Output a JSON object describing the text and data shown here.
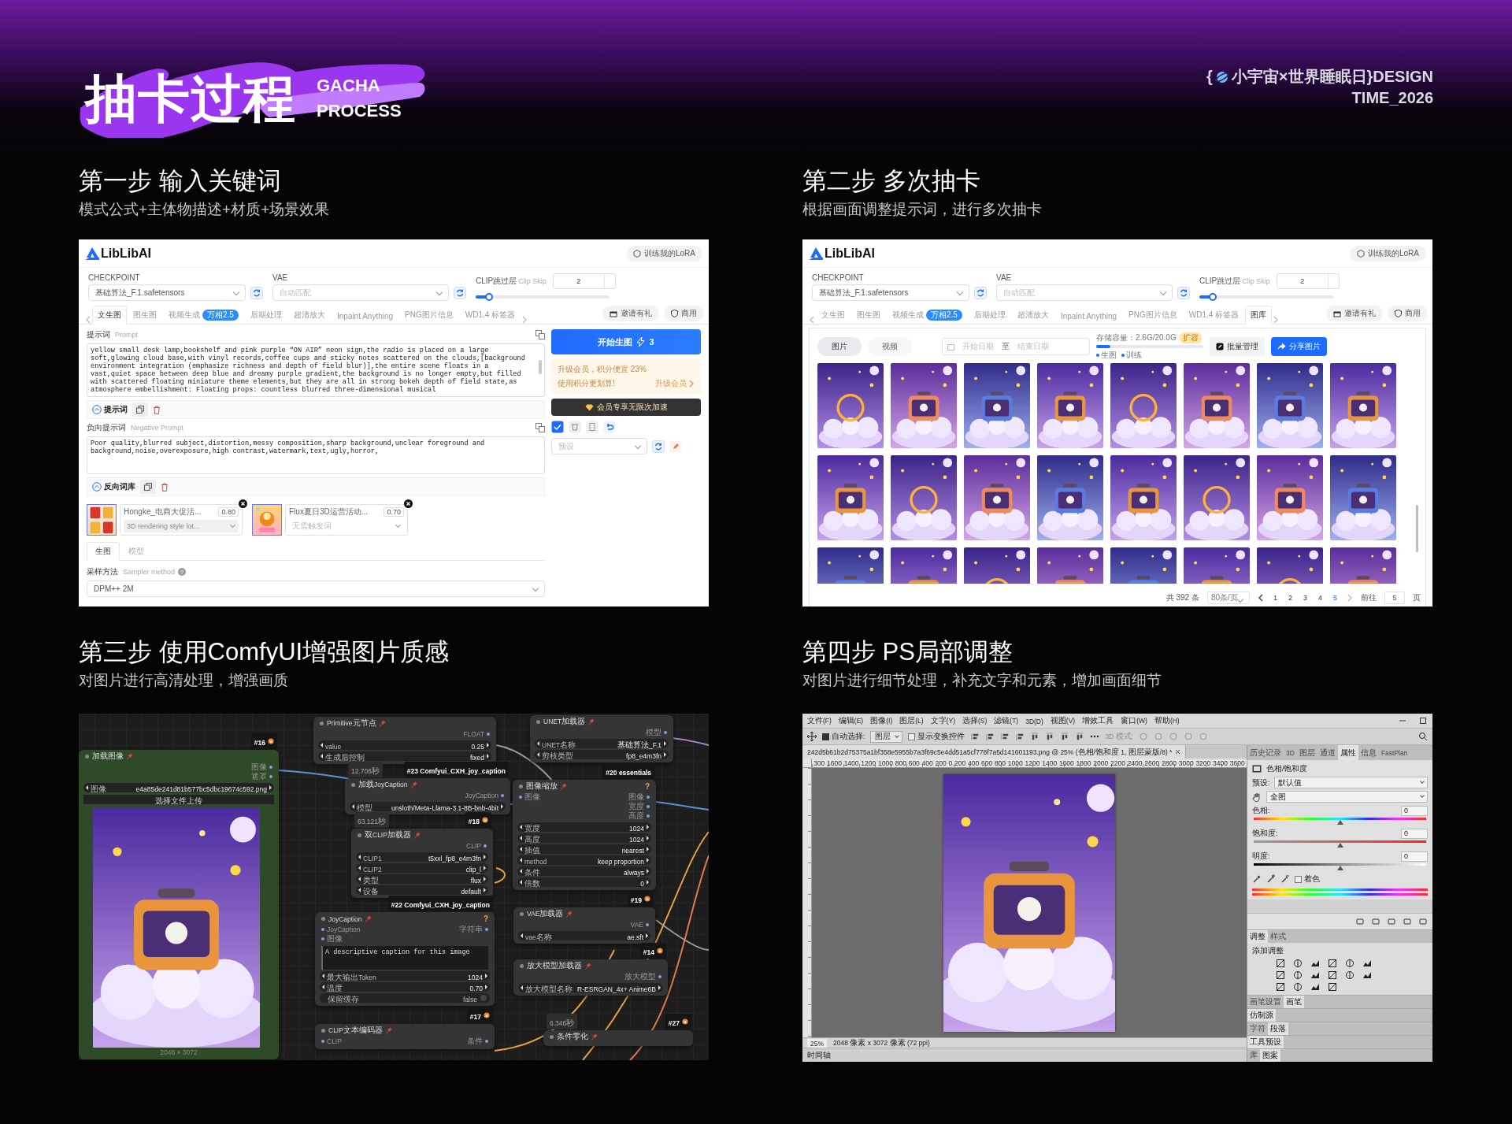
{
  "header": {
    "title": "抽卡过程",
    "tagline": [
      "GACHA",
      "PROCESS"
    ],
    "credit": {
      "open": "{",
      "name": "小宇宙×世界睡眠日}DESIGN",
      "line_2": "TIME_2026"
    }
  },
  "steps": [
    {
      "title": "第一步 输入关键词",
      "subtitle": "模式公式+主体物描述+材质+场景效果",
      "screen": {
        "kind": "generate",
        "brand": "LibLibAI",
        "lora_button": "训练我的LoRA",
        "checkpoint": {
          "label": "CHECKPOINT",
          "value": "基础算法_F.1.safetensors"
        },
        "vae": {
          "label": "VAE",
          "placeholder": "自动匹配"
        },
        "clip_skip": {
          "label": "CLIP跳过层",
          "hint": "Clip Skip",
          "value": "2",
          "level": 0.1
        },
        "tabs": [
          {
            "label": "文生图",
            "selected": true
          },
          {
            "label": "图生图",
            "selected": false
          },
          {
            "label": "视频生成",
            "badge": "万相2.5",
            "selected": false
          },
          {
            "label": "后期处理",
            "selected": false
          },
          {
            "label": "超清放大",
            "selected": false
          },
          {
            "label": "Inpaint Anything",
            "selected": false
          },
          {
            "label": "PNG图片信息",
            "selected": false
          },
          {
            "label": "WD1.4 标签器",
            "selected": false
          }
        ],
        "invite_button": "邀请有礼",
        "commercial_button": "商用",
        "prompt": {
          "label": "提示词",
          "hint": "Prompt",
          "value": "yellow small desk lamp,bookshelf and pink purple “ON AIR” neon sign,the radio is placed on a large soft,glowing cloud base,with vinyl records,coffee cups and sticky notes scattered on the clouds,[background environment integration (emphasize richness and depth of field blur)],the entire scene floats in a vast,quiet space between deep blue and dreamy purple gradient,the background is no longer empty,but filled with scattered floating miniature theme elements,but they are all in strong bokeh depth of field state,as atmosphere embellishment: Floating props: countless blurred three-dimensional musical",
          "toggle": "提示词"
        },
        "negative_prompt": {
          "label": "负向提示词",
          "hint": "Negative Prompt",
          "value": "Poor quality,blurred subject,distortion,messy composition,sharp background,unclear foreground and background,noise,overexposure,high contrast,watermark,text,ugly,horror,",
          "toggle": "反向词库"
        },
        "loras": [
          {
            "name": "Hongke_电商大促活...",
            "weight": "0.80",
            "trigger": "3D rendering style lot..."
          },
          {
            "name": "Flux夏日3D运营活动...",
            "weight": "0.70",
            "trigger_placeholder": "无需触发词"
          }
        ],
        "sub_tabs": [
          {
            "label": "生图",
            "selected": true
          },
          {
            "label": "模型",
            "selected": false
          }
        ],
        "sampler": {
          "label": "采样方法",
          "hint": "Sampler method",
          "help": "?",
          "value": "DPM++ 2M"
        },
        "generate_button": {
          "label": "开始生图",
          "cost": "3"
        },
        "upgrade": {
          "title": "升级会员，积分便宜 23%",
          "note": "使用积分更划算!",
          "link": "升级会员"
        },
        "boost_button": "会员专享无限次加速",
        "preset": {
          "placeholder": "预设"
        }
      }
    },
    {
      "title": "第二步 多次抽卡",
      "subtitle": "根据画面调整提示词，进行多次抽卡",
      "screen": {
        "kind": "gallery",
        "brand": "LibLibAI",
        "lora_button": "训练我的LoRA",
        "checkpoint": {
          "label": "CHECKPOINT",
          "value": "基础算法_F.1.safetensors"
        },
        "vae": {
          "label": "VAE",
          "placeholder": "自动匹配"
        },
        "clip_skip": {
          "label": "CLIP跳过层",
          "hint": "Clip Skip",
          "value": "2",
          "level": 0.1
        },
        "tabs": [
          {
            "label": "文生图",
            "selected": false
          },
          {
            "label": "图生图",
            "selected": false
          },
          {
            "label": "视频生成",
            "badge": "万相2.5",
            "selected": false
          },
          {
            "label": "后期处理",
            "selected": false
          },
          {
            "label": "超清放大",
            "selected": false
          },
          {
            "label": "Inpaint Anything",
            "selected": false
          },
          {
            "label": "PNG图片信息",
            "selected": false
          },
          {
            "label": "WD1.4 标签器",
            "selected": false
          },
          {
            "label": "图库",
            "selected": true
          }
        ],
        "invite_button": "邀请有礼",
        "commercial_button": "商用",
        "media_toggle": [
          {
            "label": "图片",
            "selected": true
          },
          {
            "label": "视频",
            "selected": false
          }
        ],
        "date_range": {
          "start_placeholder": "开始日期",
          "separator": "至",
          "end_placeholder": "结束日期"
        },
        "storage": {
          "label": "存储容量：2.6G/20.0G",
          "expand": "扩容",
          "level": 0.13,
          "legend": [
            "生图",
            "训练"
          ]
        },
        "batch_button": "批量管理",
        "share_button": "分享图片",
        "pagination": {
          "total": "共 392 条",
          "page_size": "80条/页",
          "pages": [
            {
              "label": "1",
              "selected": false
            },
            {
              "label": "2",
              "selected": false
            },
            {
              "label": "3",
              "selected": false
            },
            {
              "label": "4",
              "selected": false
            },
            {
              "label": "5",
              "selected": true
            }
          ],
          "goto_label": "前往",
          "goto_value": "5",
          "goto_suffix": "页"
        }
      }
    },
    {
      "title": "第三步 使用ComfyUI增强图片质感",
      "subtitle": "对图片进行高清处理，增强画质",
      "screen": {
        "kind": "node_graph",
        "nodes": [
          {
            "title": "加载图像",
            "color": "#2e4a29",
            "tag": "#16",
            "tag_icon": true,
            "outputs": [
              "图像",
              "遮罩"
            ],
            "widgets": [
              {
                "label": "图像",
                "value": "e4a85de241d81b577bc5dbc19674c592.png"
              }
            ],
            "button": "选择文件上传",
            "image": {
              "kind": "picture",
              "caption": "2048 × 3072"
            }
          },
          {
            "title": "Primitive元节点",
            "color": "#353535",
            "outputs": [
              "FLOAT"
            ],
            "widgets": [
              {
                "label": "value",
                "value": "0.25"
              },
              {
                "label": "生成后控制",
                "value": "fixed"
              }
            ]
          },
          {
            "title": "UNET加载器",
            "color": "#353535",
            "outputs": [
              "模型"
            ],
            "widgets": [
              {
                "label": "UNET名称",
                "value": "基础算法_F.1"
              },
              {
                "label": "剪枝类型",
                "value": "fp8_e4m3fn"
              }
            ]
          },
          {
            "title": "加载JoyCaption",
            "color": "#353535",
            "time": "12.706秒",
            "tag": "#23 Comfyui_CXH_joy_caption",
            "tag_icon": false,
            "outputs": [
              "JoyCaption"
            ],
            "widgets": [
              {
                "label": "模型",
                "value": "unsloth/Meta-Llama-3.1-8B-bnb-4bit"
              }
            ]
          },
          {
            "title": "图像缩放",
            "color": "#353535",
            "tag": "#20 essentials",
            "tag_icon": false,
            "help": "?",
            "inputs": [
              "图像"
            ],
            "outputs": [
              "图像",
              "宽度",
              "高度"
            ],
            "widgets": [
              {
                "label": "宽度",
                "value": "1024"
              },
              {
                "label": "高度",
                "value": "1024"
              },
              {
                "label": "插值",
                "value": "nearest"
              },
              {
                "label": "method",
                "value": "keep proportion"
              },
              {
                "label": "条件",
                "value": "always"
              },
              {
                "label": "倍数",
                "value": "0"
              }
            ]
          },
          {
            "title": "双CLIP加载器",
            "color": "#353535",
            "time": "63.121秒",
            "tag": "#18",
            "tag_icon": true,
            "outputs": [
              "CLIP"
            ],
            "widgets": [
              {
                "label": "CLIP1",
                "value": "t5xxl_fp8_e4m3fn"
              },
              {
                "label": "CLIP2",
                "value": "clip_l"
              },
              {
                "label": "类型",
                "value": "flux"
              },
              {
                "label": "设备",
                "value": "default"
              }
            ]
          },
          {
            "title": "JoyCaption",
            "color": "#353535",
            "tag": "#22 Comfyui_CXH_joy_caption",
            "tag_icon": false,
            "help": "?",
            "inputs": [
              "JoyCaption",
              "图像"
            ],
            "outputs": [
              "字符串"
            ],
            "text": "A descriptive caption for this image",
            "widgets": [
              {
                "label": "最大输出Token",
                "value": "1024"
              },
              {
                "label": "温度",
                "value": "0.70"
              }
            ],
            "toggle": {
              "label": "保留缓存",
              "value": "false",
              "on": false
            }
          },
          {
            "title": "VAE加载器",
            "color": "#353535",
            "tag": "#19",
            "tag_icon": true,
            "outputs": [
              "VAE"
            ],
            "widgets": [
              {
                "label": "vae名称",
                "value": "ae.sft"
              }
            ]
          },
          {
            "title": "放大模型加载器",
            "color": "#353535",
            "tag": "#14",
            "tag_icon": true,
            "outputs": [
              "放大模型"
            ],
            "widgets": [
              {
                "label": "放大模型名称",
                "value": "R-ESRGAN_4x+ Anime6B"
              }
            ]
          },
          {
            "title": "CLIP文本编码器",
            "color": "#353535",
            "tag": "#17",
            "tag_icon": true,
            "inputs": [
              "CLIP"
            ],
            "outputs": [
              "条件"
            ]
          },
          {
            "title": "条件零化",
            "color": "#353535",
            "time": "6.346秒",
            "tag": "#27",
            "tag_icon": true
          }
        ]
      }
    },
    {
      "title": "第四步 PS局部调整",
      "subtitle": "对图片进行细节处理，补充文字和元素，增加画面细节",
      "screen": {
        "kind": "photo_editor",
        "menu": [
          "文件(F)",
          "编辑(E)",
          "图像(I)",
          "图层(L)",
          "文字(Y)",
          "选择(S)",
          "滤镜(T)",
          "3D(D)",
          "视图(V)",
          "增效工具",
          "窗口(W)",
          "帮助(H)"
        ],
        "options": {
          "auto_select": {
            "label": "自动选择:",
            "checked": true
          },
          "target": "图层",
          "transform": {
            "label": "显示变换控件",
            "checked": false
          },
          "mode_3d": "3D 模式:"
        },
        "document_tab": "242d5b61b2d75375a1bf358e5955b7a3f69c5e4dd51a5cf778f7a5d141601193.png @ 25% (色相/饱和度 1, 图层蒙版/8) *",
        "ruler": [
          "300",
          "1600",
          "1400",
          "1200",
          "1000",
          "800",
          "600",
          "400",
          "200",
          "0",
          "200",
          "400",
          "600",
          "800",
          "1000",
          "1200",
          "1400",
          "1600",
          "1800",
          "2000",
          "2200",
          "2400",
          "2600",
          "2800",
          "3000",
          "3200",
          "3400",
          "3600"
        ],
        "status": {
          "zoom": "25%",
          "size": "2048 像素 x 3072 像素 (72 ppi)"
        },
        "timeline": "时间轴",
        "panel_tabs": [
          {
            "label": "历史记录",
            "selected": false
          },
          {
            "label": "3D",
            "selected": false
          },
          {
            "label": "图层",
            "selected": false
          },
          {
            "label": "通道",
            "selected": false
          },
          {
            "label": "属性",
            "selected": true
          },
          {
            "label": "信息",
            "selected": false
          },
          {
            "label": "FastPlan",
            "selected": false
          }
        ],
        "properties": {
          "title": "色相/饱和度",
          "preset_label": "预设:",
          "preset": "默认值",
          "range": "全图",
          "sliders": [
            {
              "kind": "hue",
              "label": "色相:",
              "value": "0",
              "level": 0.5
            },
            {
              "kind": "saturation",
              "label": "饱和度:",
              "value": "0",
              "level": 0.5
            },
            {
              "kind": "lightness",
              "label": "明度:",
              "value": "0",
              "level": 0.5
            }
          ],
          "colorize": {
            "label": "着色",
            "checked": false
          }
        },
        "adjust_tabs": [
          {
            "label": "调整",
            "selected": true
          },
          {
            "label": "样式",
            "selected": false
          }
        ],
        "adjust_title": "添加调整",
        "groups": [
          {
            "tabs": [
              {
                "label": "画笔设置",
                "selected": false
              },
              {
                "label": "画笔",
                "selected": true
              }
            ]
          },
          {
            "tabs": [
              {
                "label": "仿制源",
                "selected": true
              }
            ]
          },
          {
            "tabs": [
              {
                "label": "字符",
                "selected": false
              },
              {
                "label": "段落",
                "selected": true
              }
            ]
          },
          {
            "tabs": [
              {
                "label": "工具预设",
                "selected": true
              }
            ]
          },
          {
            "tabs": [
              {
                "label": "库",
                "selected": false
              },
              {
                "label": "图案",
                "selected": true
              }
            ]
          }
        ]
      }
    }
  ]
}
